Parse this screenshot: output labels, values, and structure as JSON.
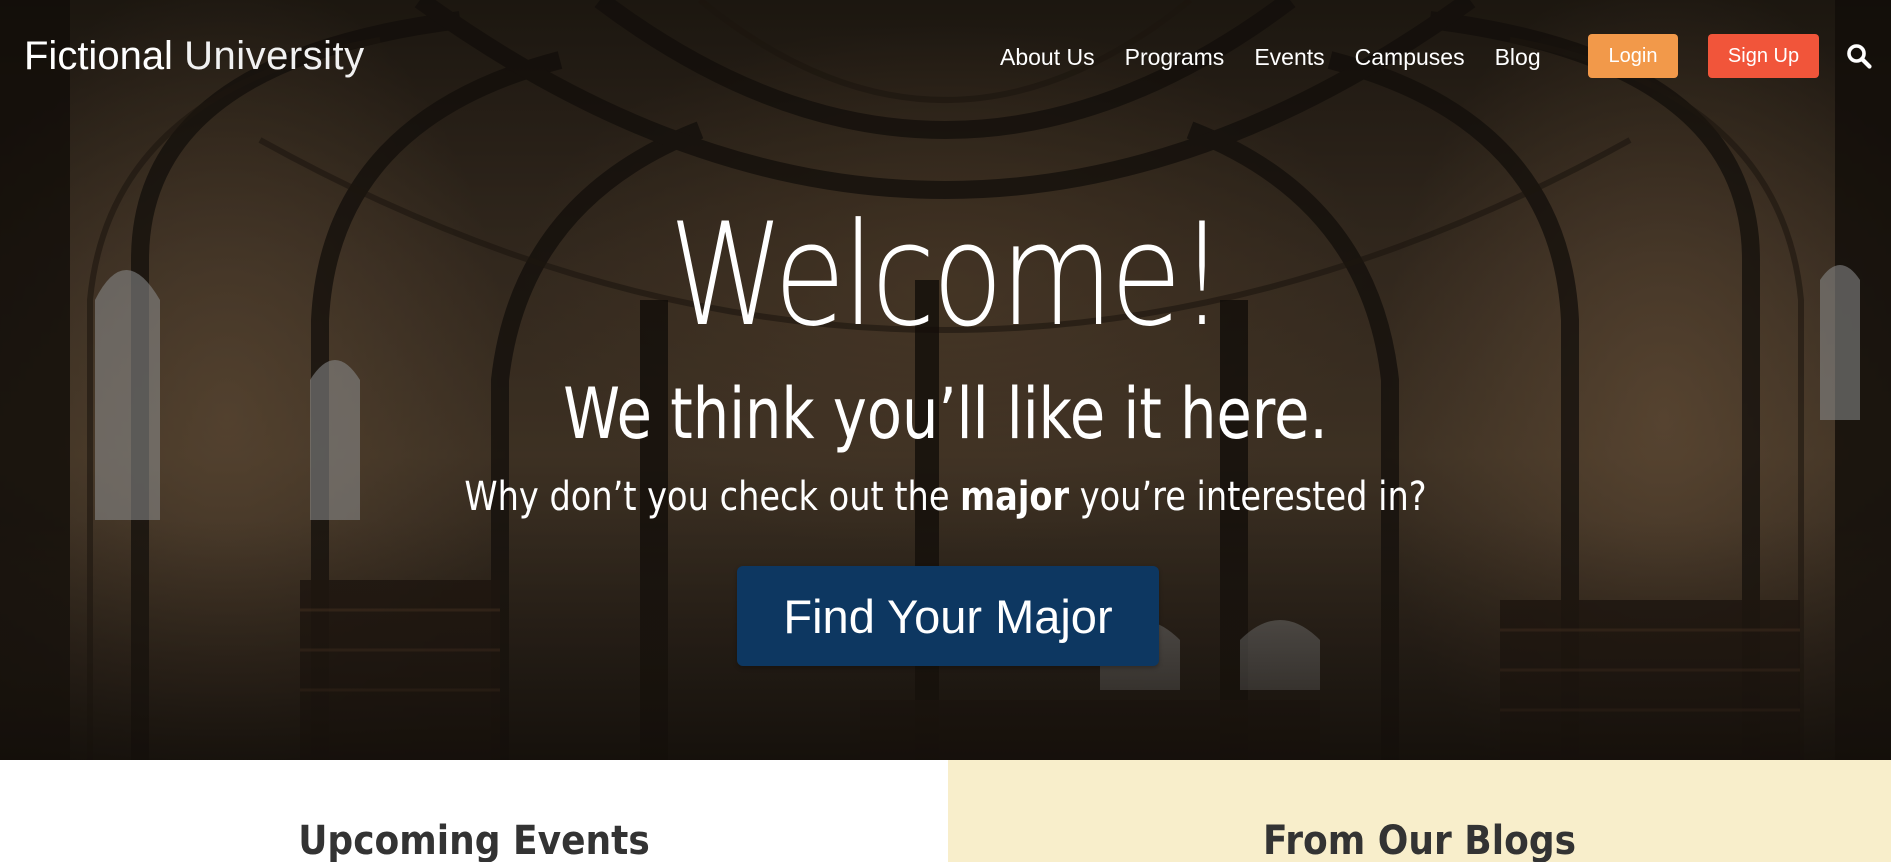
{
  "header": {
    "logo_strong": "Fictional",
    "logo_light": "University",
    "nav": [
      "About Us",
      "Programs",
      "Events",
      "Campuses",
      "Blog"
    ],
    "login_label": "Login",
    "signup_label": "Sign Up",
    "search_icon": "search-icon"
  },
  "hero": {
    "title": "Welcome!",
    "subtitle": "We think you’ll like it here.",
    "line_before": "Why don’t you check out the ",
    "line_bold": "major",
    "line_after": " you’re interested in?",
    "cta_label": "Find Your Major"
  },
  "sections": {
    "left_heading": "Upcoming Events",
    "right_heading": "From Our Blogs"
  },
  "colors": {
    "login": "#f2994a",
    "signup": "#f1553a",
    "cta": "#0d3761",
    "blog_bg": "#f8eecb"
  }
}
